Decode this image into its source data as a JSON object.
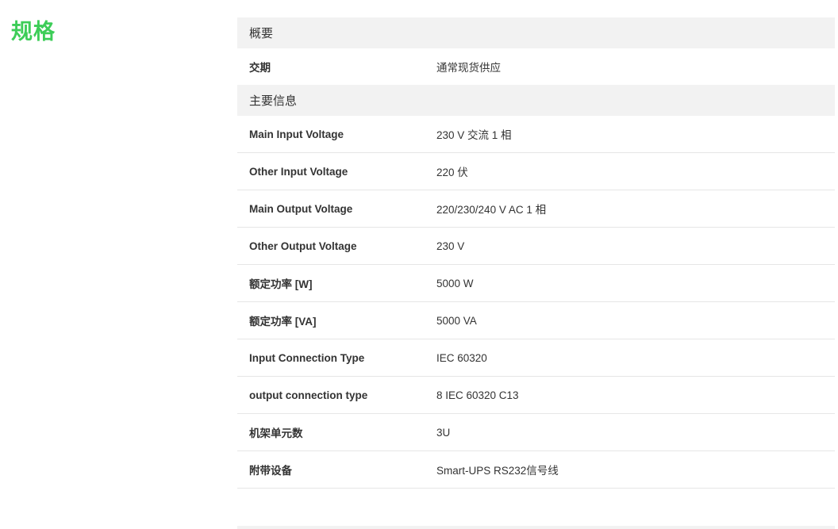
{
  "page": {
    "title": "规格"
  },
  "sections": [
    {
      "header": "概要",
      "rows": [
        {
          "label": "交期",
          "value": "通常现货供应"
        }
      ]
    },
    {
      "header": "主要信息",
      "rows": [
        {
          "label": "Main Input Voltage",
          "value": "230 V 交流 1 相"
        },
        {
          "label": "Other Input Voltage",
          "value": "220 伏"
        },
        {
          "label": "Main Output Voltage",
          "value": "220/230/240 V AC 1 相"
        },
        {
          "label": "Other Output Voltage",
          "value": "230 V"
        },
        {
          "label": "额定功率 [W]",
          "value": "5000 W"
        },
        {
          "label": "额定功率 [VA]",
          "value": "5000 VA"
        },
        {
          "label": "Input Connection Type",
          "value": "IEC 60320"
        },
        {
          "label": "output connection type",
          "value": "8 IEC 60320 C13"
        },
        {
          "label": "机架单元数",
          "value": "3U"
        },
        {
          "label": "附带设备",
          "value": "Smart-UPS RS232信号线"
        }
      ]
    }
  ],
  "colors": {
    "accent": "#3dcd58",
    "header_bg": "#f2f2f2",
    "divider": "#e6e6e6"
  }
}
